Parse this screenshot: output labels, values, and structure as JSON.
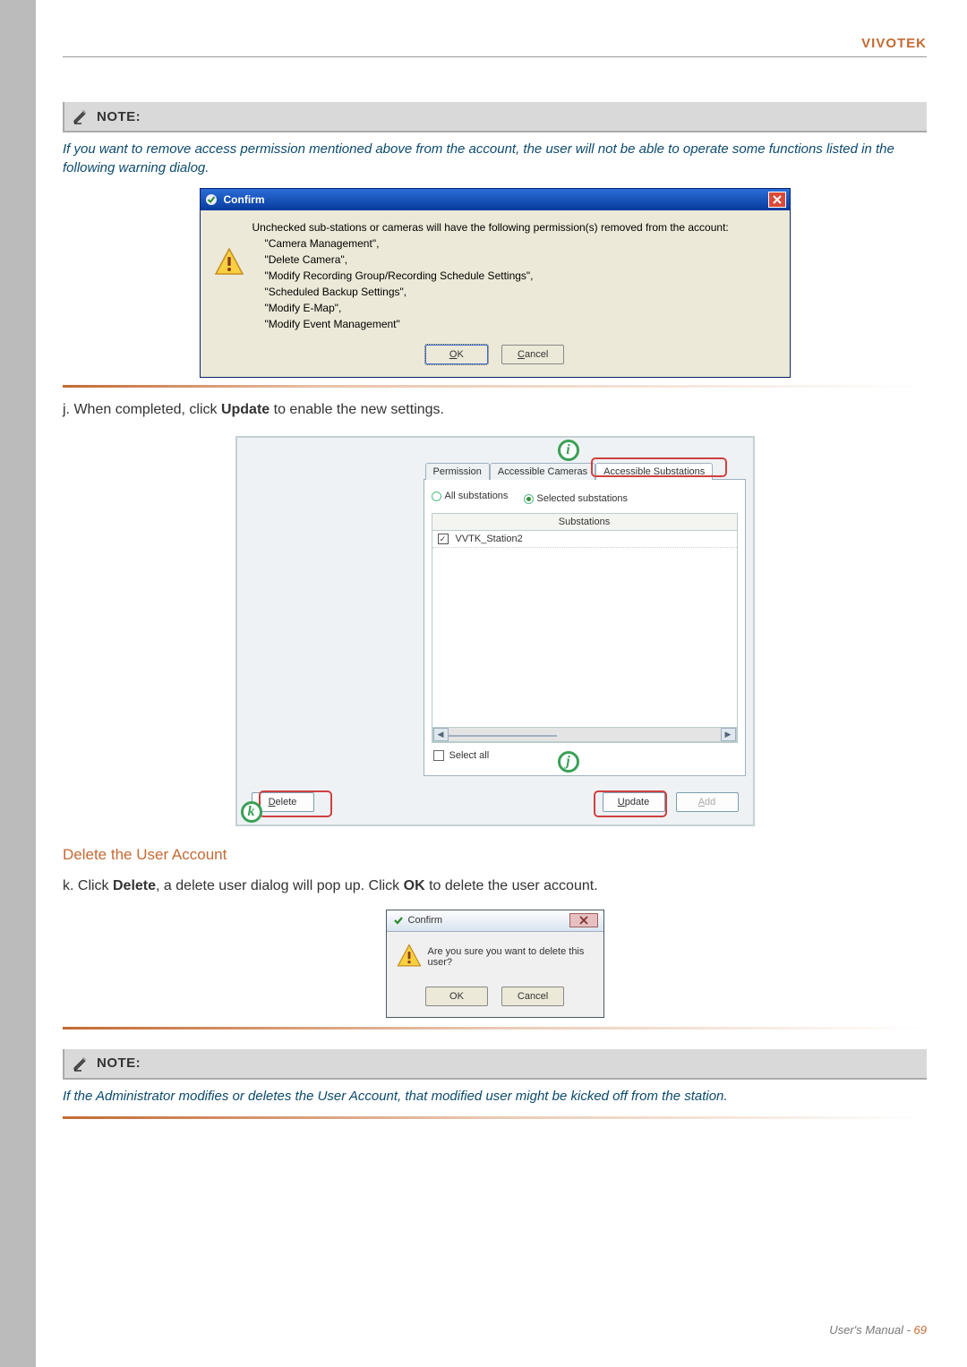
{
  "brand": "VIVOTEK",
  "note_label": "NOTE:",
  "note_intro": "If you want to remove access permission mentioned above from the account, the user will not be able to operate some functions listed in the following warning dialog.",
  "dlg1": {
    "title": "Confirm",
    "line1": "Unchecked sub-stations or cameras will have the following permission(s) removed from the account:",
    "perm1": "\"Camera Management\",",
    "perm2": "\"Delete Camera\",",
    "perm3": "\"Modify Recording Group/Recording Schedule Settings\",",
    "perm4": "\"Scheduled Backup Settings\",",
    "perm5": "\"Modify E-Map\",",
    "perm6": "\"Modify Event Management\"",
    "ok": "OK",
    "cancel": "Cancel"
  },
  "step_j_prefix": "j. When completed, click ",
  "step_j_bold": "Update",
  "step_j_suffix": " to enable the new settings.",
  "panel": {
    "tab1": "Permission",
    "tab2": "Accessible Cameras",
    "tab3": "Accessible Substations",
    "radio_all": "All substations",
    "radio_sel": "Selected substations",
    "col_header": "Substations",
    "row1": "VVTK_Station2",
    "select_all": "Select all",
    "delete_btn": "Delete",
    "update_btn": "Update",
    "add_btn": "Add"
  },
  "section_heading": "Delete the User Account",
  "step_k_prefix": "k. Click ",
  "step_k_bold1": "Delete",
  "step_k_mid": ", a delete user dialog will pop up. Click ",
  "step_k_bold2": "OK",
  "step_k_suffix": " to delete the user account.",
  "dlg2": {
    "title": "Confirm",
    "text": "Are you sure you want to delete this user?",
    "ok": "OK",
    "cancel": "Cancel"
  },
  "note2": "If the Administrator modifies or deletes the User Account, that modified user might be kicked off from the station.",
  "footer_label": "User's Manual - ",
  "footer_page": "69",
  "callouts": {
    "i": "i",
    "j": "j",
    "k": "k"
  }
}
